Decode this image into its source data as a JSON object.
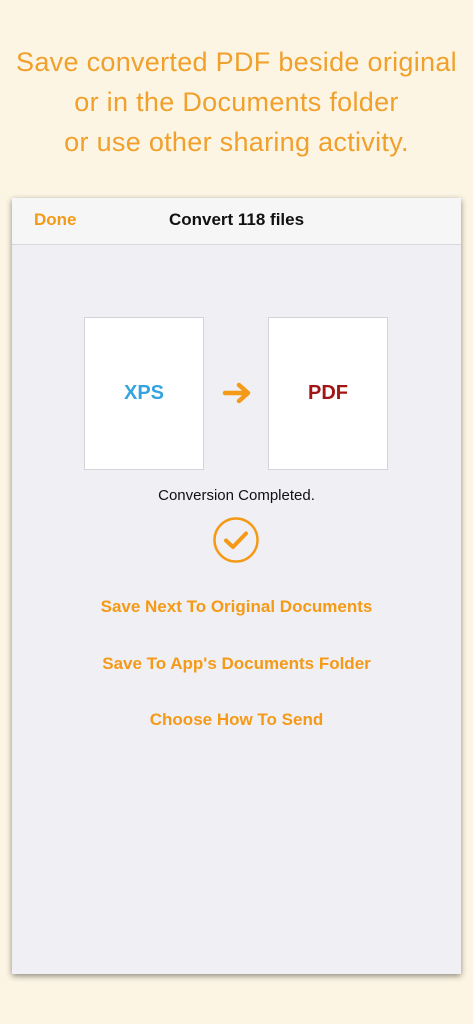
{
  "caption": {
    "line1": "Save converted PDF beside original",
    "line2": "or in the Documents folder",
    "line3": "or use other sharing activity."
  },
  "navbar": {
    "done_label": "Done",
    "title": "Convert 118 files"
  },
  "conversion": {
    "source_format": "XPS",
    "target_format": "PDF",
    "status": "Conversion Completed.",
    "arrow_icon": "arrow-right-icon",
    "check_icon": "checkmark-circle-icon"
  },
  "actions": {
    "save_next": "Save Next To Original Documents",
    "save_documents": "Save To App's Documents Folder",
    "choose_send": "Choose How To Send"
  },
  "colors": {
    "accent": "#f49a16",
    "caption": "#f0a02c",
    "xps": "#35a3e0",
    "pdf": "#a11515",
    "background": "#fdf5e4",
    "screen": "#efeff4"
  }
}
